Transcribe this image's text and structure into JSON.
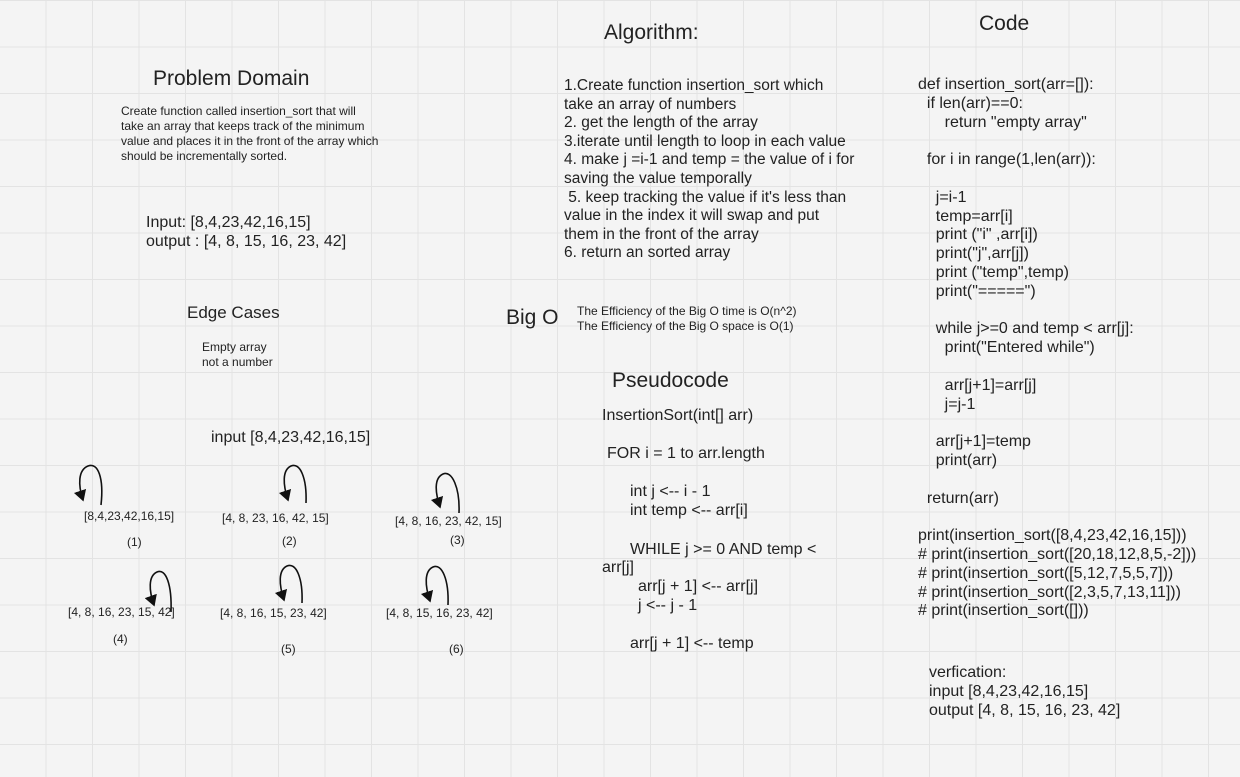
{
  "problem": {
    "title": "Problem Domain",
    "description": [
      "Create function called insertion_sort that will",
      "take an array that keeps track of the minimum",
      "value and places it in the front of the array which",
      "should be incrementally sorted."
    ],
    "input": "Input: [8,4,23,42,16,15]",
    "output": "output : [4, 8, 15, 16, 23, 42]"
  },
  "edge": {
    "title": "Edge Cases",
    "items": [
      "Empty array",
      "not a number"
    ]
  },
  "trace": {
    "input": "input [8,4,23,42,16,15]",
    "steps": [
      {
        "array": "[8,4,23,42,16,15]",
        "label": "(1)"
      },
      {
        "array": "[4, 8, 23, 16, 42, 15]",
        "label": "(2)"
      },
      {
        "array": "[4, 8, 16, 23, 42, 15]",
        "label": "(3)"
      },
      {
        "array": "[4, 8, 16, 23, 15, 42]",
        "label": "(4)"
      },
      {
        "array": "[4, 8, 16, 15, 23, 42]",
        "label": "(5)"
      },
      {
        "array": "[4, 8, 15, 16, 23, 42]",
        "label": "(6)"
      }
    ]
  },
  "algorithm": {
    "title": "Algorithm:",
    "lines": [
      "1.Create function insertion_sort which",
      "take an array of numbers",
      "2. get the length of the array",
      "3.iterate until length to loop in each value",
      "4. make j =i-1 and temp = the value of i for",
      "saving the value temporally",
      " 5. keep tracking the value if it's less than",
      "value in the index it will swap and put",
      "them in the front of the array",
      "6. return an sorted array"
    ]
  },
  "bigo": {
    "title": "Big O",
    "time": "The Efficiency of the Big O time is O(n^2)",
    "space": "The Efficiency of the Big O space is O(1)"
  },
  "pseudo": {
    "title": "Pseudocode",
    "header": "InsertionSort(int[] arr)",
    "loop": "FOR i = 1 to arr.length",
    "inner": [
      "int j <-- i - 1",
      "int temp <-- arr[i]"
    ],
    "while_line": "WHILE j >= 0 AND temp <",
    "while_cont": "arr[j]",
    "while_body": [
      "arr[j + 1] <-- arr[j]",
      "j <-- j - 1"
    ],
    "final": "arr[j + 1] <-- temp"
  },
  "code": {
    "title": "Code",
    "lines": [
      "def insertion_sort(arr=[]):",
      "  if len(arr)==0:",
      "      return \"empty array\"",
      "",
      "  for i in range(1,len(arr)):",
      "",
      "    j=i-1",
      "    temp=arr[i]",
      "    print (\"i\" ,arr[i])",
      "    print(\"j\",arr[j])",
      "    print (\"temp\",temp)",
      "    print(\"=====\")",
      "",
      "    while j>=0 and temp < arr[j]:",
      "      print(\"Entered while\")",
      "",
      "      arr[j+1]=arr[j]",
      "      j=j-1",
      "",
      "    arr[j+1]=temp",
      "    print(arr)",
      "",
      "  return(arr)",
      "",
      "print(insertion_sort([8,4,23,42,16,15]))",
      "# print(insertion_sort([20,18,12,8,5,-2]))",
      "# print(insertion_sort([5,12,7,5,5,7]))",
      "# print(insertion_sort([2,3,5,7,13,11]))",
      "# print(insertion_sort([]))"
    ],
    "verification": [
      "verfication:",
      "input [8,4,23,42,16,15]",
      "output [4, 8, 15, 16, 23, 42]"
    ]
  }
}
